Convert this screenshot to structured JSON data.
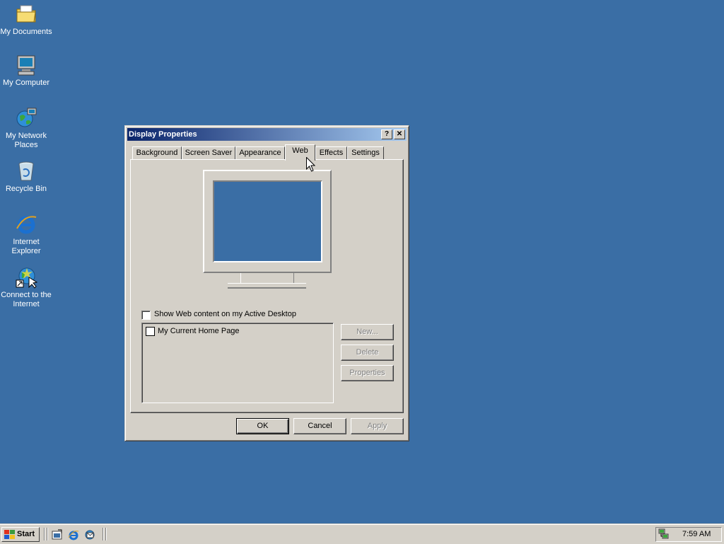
{
  "desktop": {
    "icons": [
      {
        "label": "My Documents"
      },
      {
        "label": "My Computer"
      },
      {
        "label": "My Network Places"
      },
      {
        "label": "Recycle Bin"
      },
      {
        "label": "Internet Explorer"
      },
      {
        "label": "Connect to the Internet"
      }
    ]
  },
  "window": {
    "title": "Display Properties",
    "help_glyph": "?",
    "close_glyph": "✕",
    "tabs": [
      {
        "label": "Background"
      },
      {
        "label": "Screen Saver"
      },
      {
        "label": "Appearance"
      },
      {
        "label": "Web"
      },
      {
        "label": "Effects"
      },
      {
        "label": "Settings"
      }
    ],
    "active_tab": "Web",
    "show_web_content_label": "Show Web content on my Active Desktop",
    "show_web_content_checked": false,
    "web_items": [
      {
        "label": "My Current Home Page",
        "checked": false
      }
    ],
    "side_buttons": {
      "new": "New...",
      "delete": "Delete",
      "properties": "Properties"
    },
    "footer_buttons": {
      "ok": "OK",
      "cancel": "Cancel",
      "apply": "Apply"
    }
  },
  "taskbar": {
    "start_label": "Start",
    "clock": "7:59 AM"
  },
  "colors": {
    "desktop": "#3a6ea5",
    "face": "#d4d0c8",
    "title_active": "#0a246a"
  }
}
